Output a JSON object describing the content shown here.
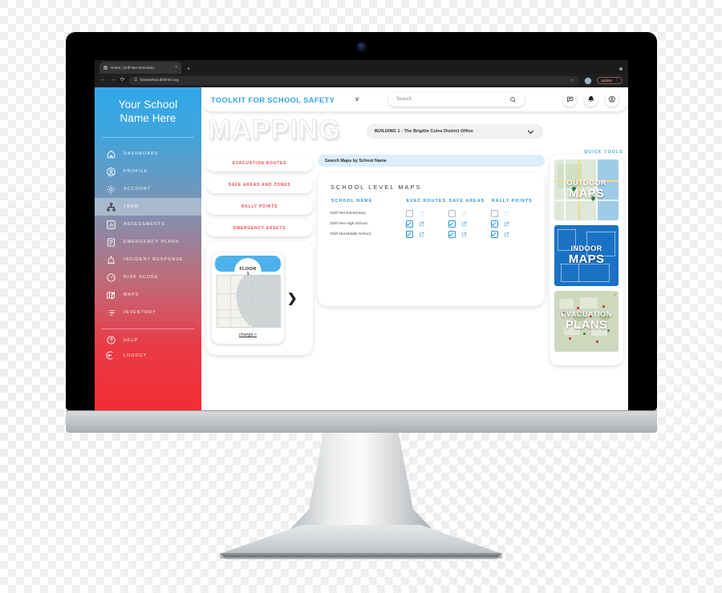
{
  "browser": {
    "tab_title": "Home | Drift Net Securities",
    "tab_close": "×",
    "new_tab": "+",
    "back": "←",
    "forward": "→",
    "reload": "⟳",
    "lock": "⚿",
    "url": "knowwhat.driftnet.org",
    "star": "☆",
    "update_label": "Update",
    "kebab": "⋮",
    "window_dot": ""
  },
  "sidebar": {
    "brand": "Your School\nName Here",
    "brand_line1": "Your School",
    "brand_line2": "Name Here",
    "items": [
      {
        "label": "DASHBOARD",
        "icon": "home-icon",
        "active": false
      },
      {
        "label": "PROFILE",
        "icon": "user-circle-icon",
        "active": false
      },
      {
        "label": "ACCOUNT",
        "icon": "gear-icon",
        "active": false
      },
      {
        "label": "TEAM",
        "icon": "org-chart-icon",
        "active": true
      },
      {
        "label": "ASSESSMENTS",
        "icon": "bar-chart-icon",
        "active": false
      },
      {
        "label": "EMERGENCY PLANS",
        "icon": "clipboard-icon",
        "active": false
      },
      {
        "label": "INCIDENT RESPONSE",
        "icon": "alarm-icon",
        "active": false
      },
      {
        "label": "RISK SCORE",
        "icon": "gauge-icon",
        "active": false
      },
      {
        "label": "MAPS",
        "icon": "map-pin-icon",
        "active": false
      },
      {
        "label": "INVENTORY",
        "icon": "list-icon",
        "active": false
      }
    ],
    "footer_items": [
      {
        "label": "HELP",
        "icon": "question-circle-icon"
      },
      {
        "label": "LOGOUT",
        "icon": "logout-icon"
      }
    ]
  },
  "topbar": {
    "title": "TOOLKIT FOR SCHOOL SAFETY",
    "caret": "∨",
    "search_placeholder": "Search",
    "search_value": "",
    "icons": [
      "chat-icon",
      "bell-icon",
      "account-icon"
    ]
  },
  "hero": {
    "watermark": "MAPPING",
    "building_selected": "BUILDING 1 - The Brigitte Coles District Office",
    "quick_tools_label": "QUICK TOOLS"
  },
  "left_actions": [
    {
      "label": "EVACUATION ROUTES"
    },
    {
      "label": "SAFE AREAS AND ZONES"
    },
    {
      "label": "RALLY POINTS"
    },
    {
      "label": "EMERGENCY ASSETS"
    }
  ],
  "floor_card": {
    "badge_title": "FLOOR",
    "badge_number": "1",
    "change_link": "change >",
    "next_arrow": "❯"
  },
  "maps_panel": {
    "search_placeholder": "Search Maps by School Name",
    "heading": "SCHOOL LEVEL MAPS",
    "columns": [
      "SCHOOL NAME",
      "EVAC ROUTES",
      "SAFE AREAS",
      "RALLY POINTS"
    ],
    "rows": [
      {
        "school": "Drift Net Elementary",
        "evac": false,
        "safe": false,
        "rally": false
      },
      {
        "school": "Drift Net High School",
        "evac": true,
        "safe": true,
        "rally": true
      },
      {
        "school": "Drift Net Middle School",
        "evac": true,
        "safe": true,
        "rally": true
      }
    ]
  },
  "quick_tools": [
    {
      "line1": "OUTDOOR",
      "line2": "MAPS",
      "art": "outdoor-map-thumbnail"
    },
    {
      "line1": "INDOOR",
      "line2": "MAPS",
      "art": "indoor-map-thumbnail"
    },
    {
      "line1": "EVACUATION",
      "line2": "PLANS",
      "art": "evacuation-plan-thumbnail"
    }
  ],
  "colors": {
    "brand_blue": "#34a5e6",
    "brand_red": "#f0464f",
    "sidebar_top": "#32a8e8",
    "sidebar_bottom": "#f32c33",
    "search_blue": "#dbeefb",
    "checkbox_blue": "#2f93e0"
  }
}
